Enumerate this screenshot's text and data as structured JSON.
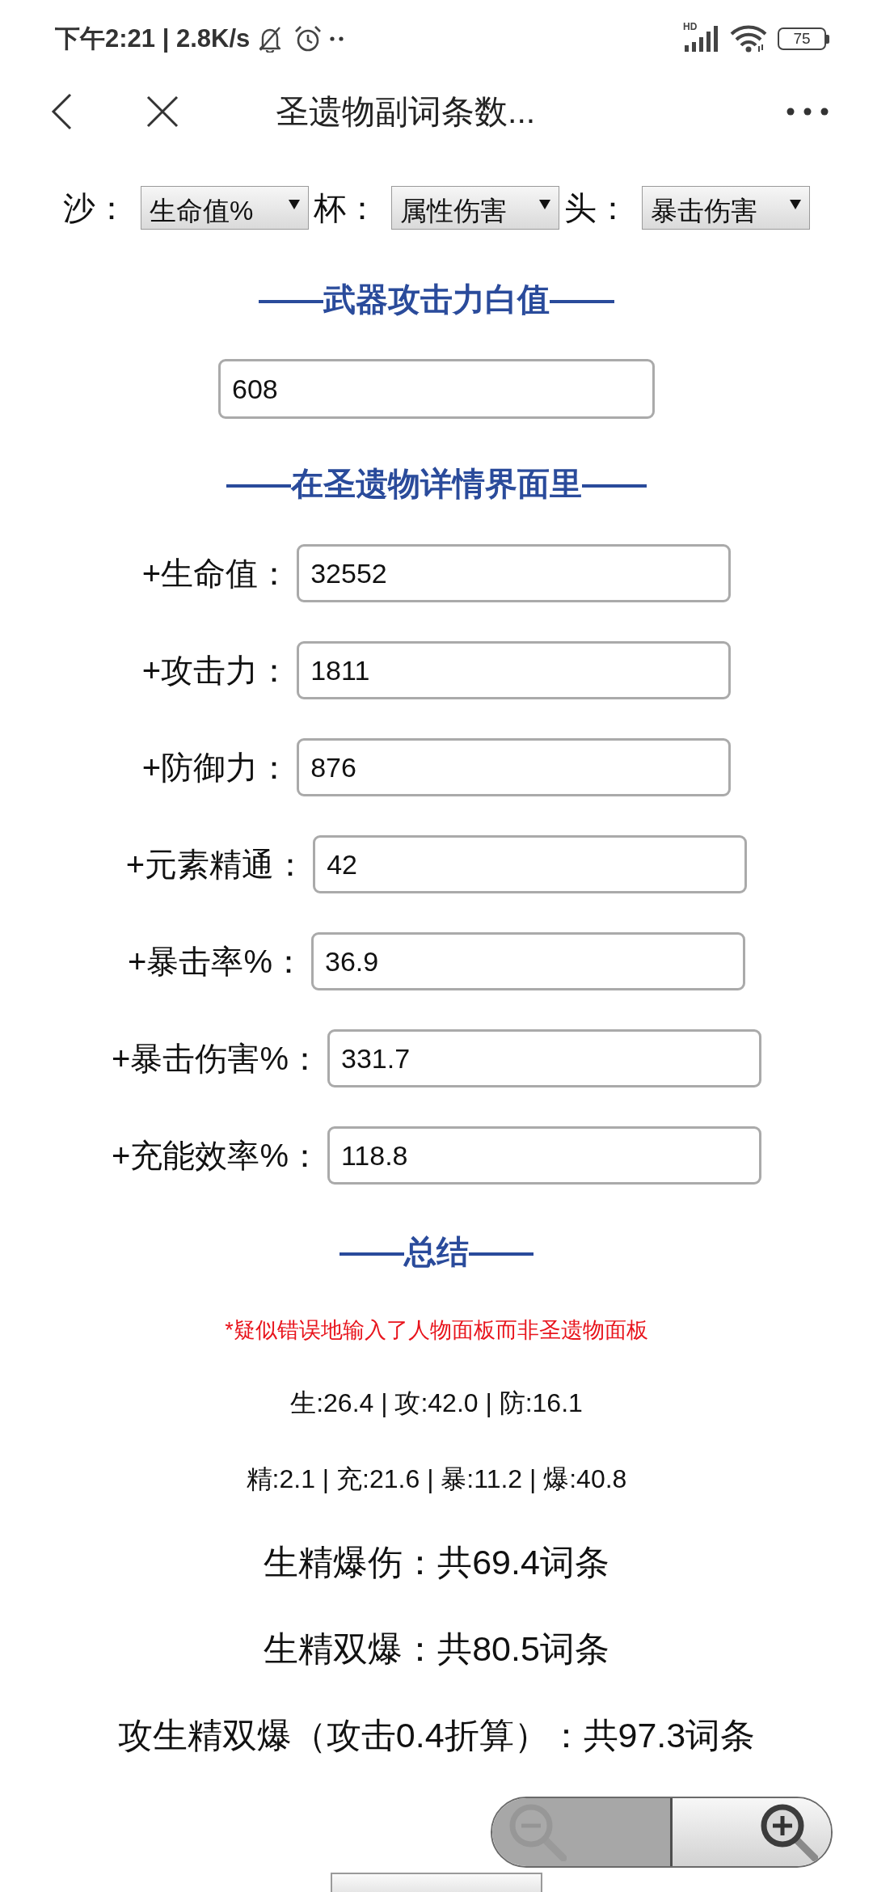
{
  "status_bar": {
    "time_speed": "下午2:21 | 2.8K/s",
    "network_badge": "HD",
    "battery": "75"
  },
  "nav_bar": {
    "title": "圣遗物副词条数..."
  },
  "selects": [
    {
      "label": "沙：",
      "value": "生命值%"
    },
    {
      "label": "杯：",
      "value": "属性伤害"
    },
    {
      "label": "头：",
      "value": "暴击伤害"
    }
  ],
  "weapon_section": {
    "heading": "——武器攻击力白值——",
    "field": {
      "value": "608"
    }
  },
  "artifact_section": {
    "heading": "——在圣遗物详情界面里——",
    "fields": [
      {
        "label": "+生命值：",
        "value": "32552"
      },
      {
        "label": "+攻击力：",
        "value": "1811"
      },
      {
        "label": "+防御力：",
        "value": "876"
      },
      {
        "label": "+元素精通：",
        "value": "42"
      },
      {
        "label": "+暴击率%：",
        "value": "36.9"
      },
      {
        "label": "+暴击伤害%：",
        "value": "331.7"
      },
      {
        "label": "+充能效率%：",
        "value": "118.8"
      }
    ]
  },
  "summary": {
    "heading": "——总结——",
    "warning": "*疑似错误地输入了人物面板而非圣遗物面板",
    "stat_lines": [
      "生:26.4 | 攻:42.0 | 防:16.1",
      "精:2.1 | 充:21.6 | 暴:11.2 | 爆:40.8"
    ],
    "totals": [
      "生精爆伤：共69.4词条",
      "生精双爆：共80.5词条",
      "攻生精双爆（攻击0.4折算）：共97.3词条"
    ]
  },
  "zoom_controls": [
    {
      "kind": "zoom_out",
      "disabled": true
    },
    {
      "kind": "zoom_in",
      "disabled": false
    }
  ]
}
